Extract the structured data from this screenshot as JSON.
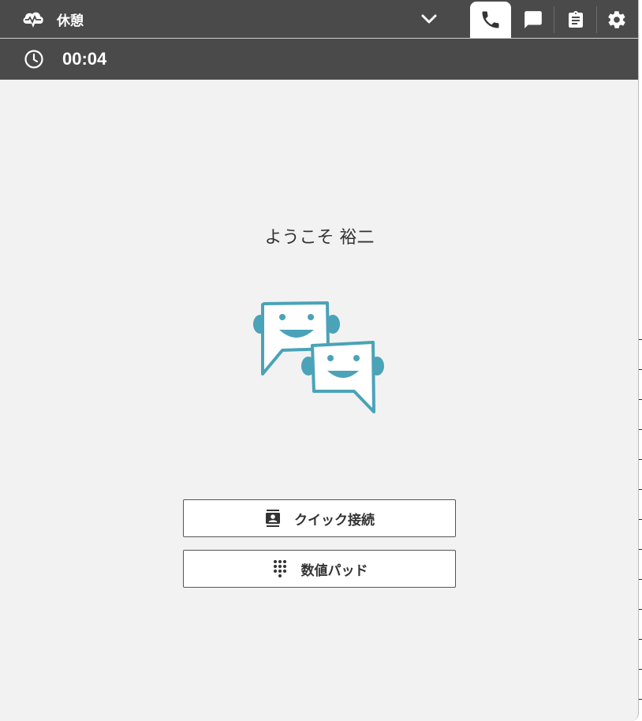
{
  "header": {
    "status_label": "休憩",
    "status_icon": "cloud-signal-icon",
    "tabs": [
      {
        "name": "phone",
        "icon": "phone-icon",
        "active": true
      },
      {
        "name": "chat",
        "icon": "chat-icon",
        "active": false
      },
      {
        "name": "clipboard",
        "icon": "clipboard-icon",
        "active": false
      },
      {
        "name": "settings",
        "icon": "gear-icon",
        "active": false
      }
    ]
  },
  "timer": {
    "value": "00:04",
    "icon": "clock-icon"
  },
  "main": {
    "welcome_text": "ようこそ 裕二",
    "mascot_icon": "chat-bubbles-smile-icon",
    "quick_connect_label": "クイック接続",
    "dialpad_label": "数値パッド"
  },
  "colors": {
    "bar": "#4a4a4a",
    "panel": "#f2f2f2",
    "accent": "#4aa3b8",
    "text": "#333333"
  }
}
